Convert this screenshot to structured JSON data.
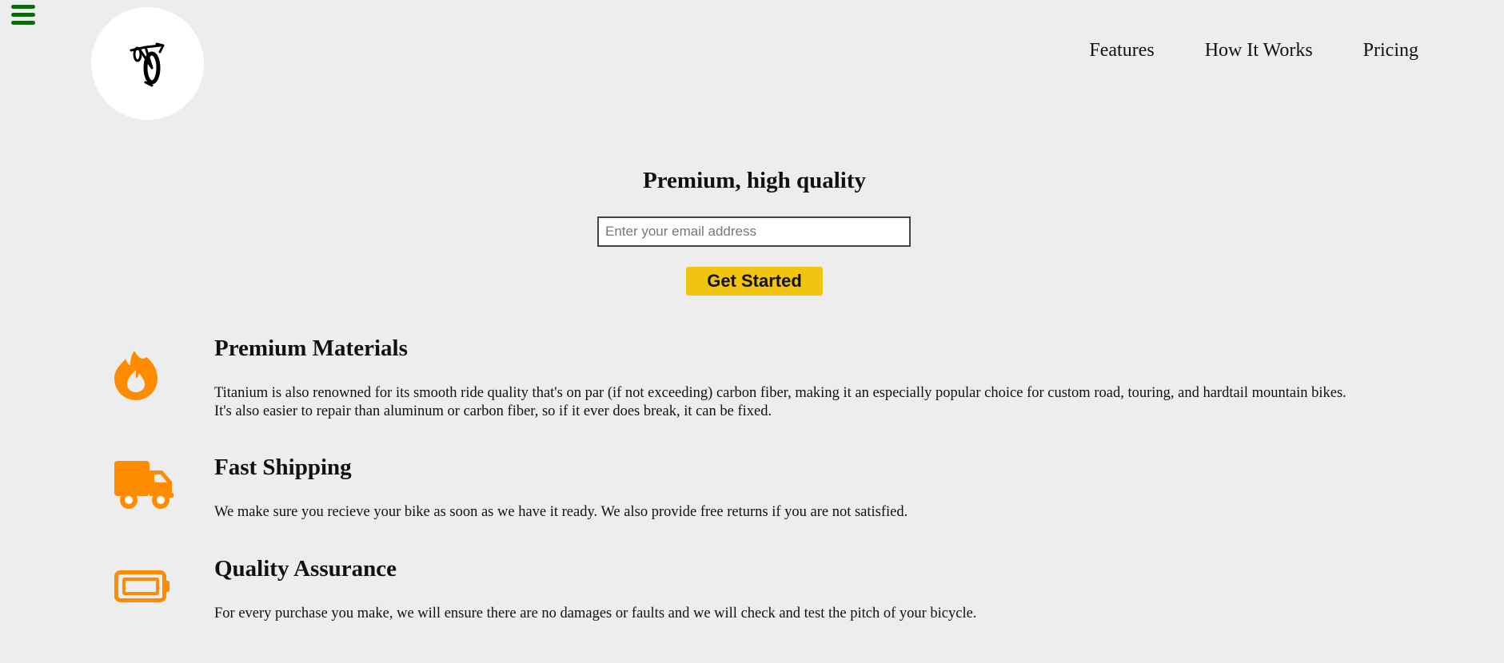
{
  "menu": {
    "icon": "hamburger-menu-icon"
  },
  "logo": {
    "icon": "bicycle-icon"
  },
  "nav": {
    "items": [
      {
        "label": "Features"
      },
      {
        "label": "How It Works"
      },
      {
        "label": "Pricing"
      }
    ]
  },
  "hero": {
    "title": "Premium, high quality",
    "email_placeholder": "Enter your email address",
    "email_value": "",
    "cta_label": "Get Started"
  },
  "features": [
    {
      "icon": "fire-icon",
      "title": "Premium Materials",
      "text": "Titanium is also renowned for its smooth ride quality that's on par (if not exceeding) carbon fiber, making it an especially popular choice for custom road, touring, and hardtail mountain bikes. It's also easier to repair than aluminum or carbon fiber, so if it ever does break, it can be fixed."
    },
    {
      "icon": "truck-icon",
      "title": "Fast Shipping",
      "text": "We make sure you recieve your bike as soon as we have it ready. We also provide free returns if you are not satisfied."
    },
    {
      "icon": "battery-icon",
      "title": "Quality Assurance",
      "text": "For every purchase you make, we will ensure there are no damages or faults and we will check and test the pitch of your bicycle."
    }
  ],
  "colors": {
    "background": "#ededed",
    "menu_green": "#0b6a0b",
    "icon_orange": "#ff8c00",
    "cta_yellow": "#f1c40f"
  }
}
